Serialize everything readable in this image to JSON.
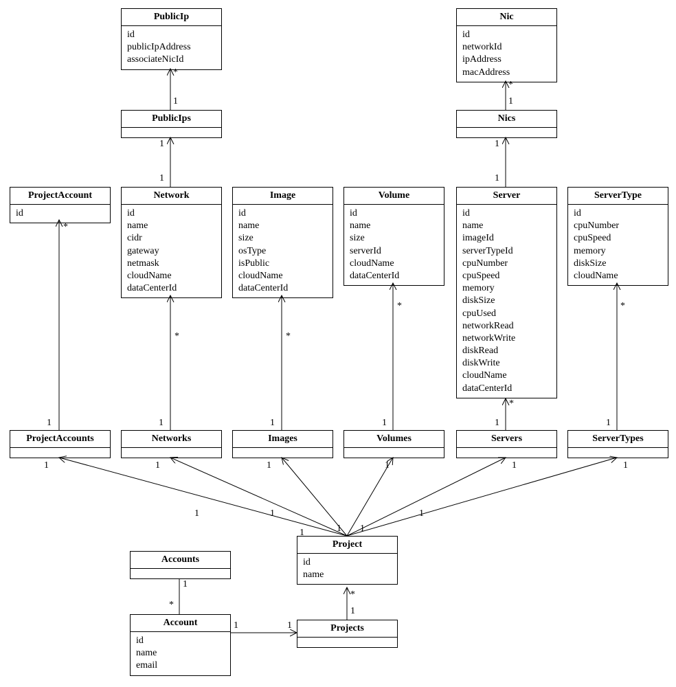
{
  "classes": {
    "PublicIp": {
      "title": "PublicIp",
      "attrs": [
        "id",
        "publicIpAddress",
        "associateNicId"
      ]
    },
    "PublicIps": {
      "title": "PublicIps"
    },
    "Nic": {
      "title": "Nic",
      "attrs": [
        "id",
        "networkId",
        "ipAddress",
        "macAddress"
      ]
    },
    "Nics": {
      "title": "Nics"
    },
    "ProjectAccount": {
      "title": "ProjectAccount",
      "attrs": [
        "id"
      ]
    },
    "Network": {
      "title": "Network",
      "attrs": [
        "id",
        "name",
        "cidr",
        "gateway",
        "netmask",
        "cloudName",
        "dataCenterId"
      ]
    },
    "Image": {
      "title": "Image",
      "attrs": [
        "id",
        "name",
        "size",
        "osType",
        "isPublic",
        "cloudName",
        "dataCenterId"
      ]
    },
    "Volume": {
      "title": "Volume",
      "attrs": [
        "id",
        "name",
        "size",
        "serverId",
        "cloudName",
        "dataCenterId"
      ]
    },
    "Server": {
      "title": "Server",
      "attrs": [
        "id",
        "name",
        "imageId",
        "serverTypeId",
        "cpuNumber",
        "cpuSpeed",
        "memory",
        "diskSize",
        "cpuUsed",
        "networkRead",
        "networkWrite",
        "diskRead",
        "diskWrite",
        "cloudName",
        "dataCenterId"
      ]
    },
    "ServerType": {
      "title": "ServerType",
      "attrs": [
        "id",
        "cpuNumber",
        "cpuSpeed",
        "memory",
        "diskSize",
        "cloudName"
      ]
    },
    "ProjectAccounts": {
      "title": "ProjectAccounts"
    },
    "Networks": {
      "title": "Networks"
    },
    "Images": {
      "title": "Images"
    },
    "Volumes": {
      "title": "Volumes"
    },
    "Servers": {
      "title": "Servers"
    },
    "ServerTypes": {
      "title": "ServerTypes"
    },
    "Project": {
      "title": "Project",
      "attrs": [
        "id",
        "name"
      ]
    },
    "Projects": {
      "title": "Projects"
    },
    "Accounts": {
      "title": "Accounts"
    },
    "Account": {
      "title": "Account",
      "attrs": [
        "id",
        "name",
        "email"
      ]
    }
  },
  "mult": {
    "one": "1",
    "many": "*"
  }
}
